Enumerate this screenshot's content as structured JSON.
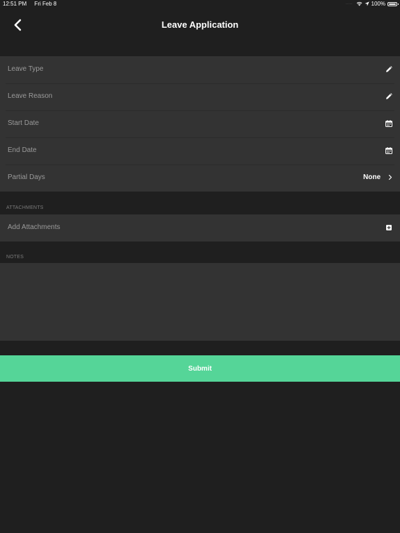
{
  "status_bar": {
    "time": "12:51 PM",
    "date": "Fri Feb 8",
    "battery": "100%",
    "battery_level": 1.0
  },
  "nav": {
    "title": "Leave Application",
    "back_icon": "chevron-left-icon"
  },
  "form": {
    "rows": [
      {
        "label": "Leave Type",
        "icon": "pencil-icon"
      },
      {
        "label": "Leave Reason",
        "icon": "pencil-icon"
      },
      {
        "label": "Start Date",
        "icon": "calendar-icon"
      },
      {
        "label": "End Date",
        "icon": "calendar-icon"
      },
      {
        "label": "Partial Days",
        "value": "None",
        "icon": "chevron-right-icon"
      }
    ]
  },
  "attachments": {
    "header": "ATTACHMENTS",
    "add_label": "Add Attachments",
    "icon": "plus-square-icon"
  },
  "notes": {
    "header": "NOTES",
    "value": ""
  },
  "submit": {
    "label": "Submit"
  },
  "colors": {
    "background": "#1f1f1f",
    "row_background": "#333333",
    "accent": "#55d598"
  }
}
